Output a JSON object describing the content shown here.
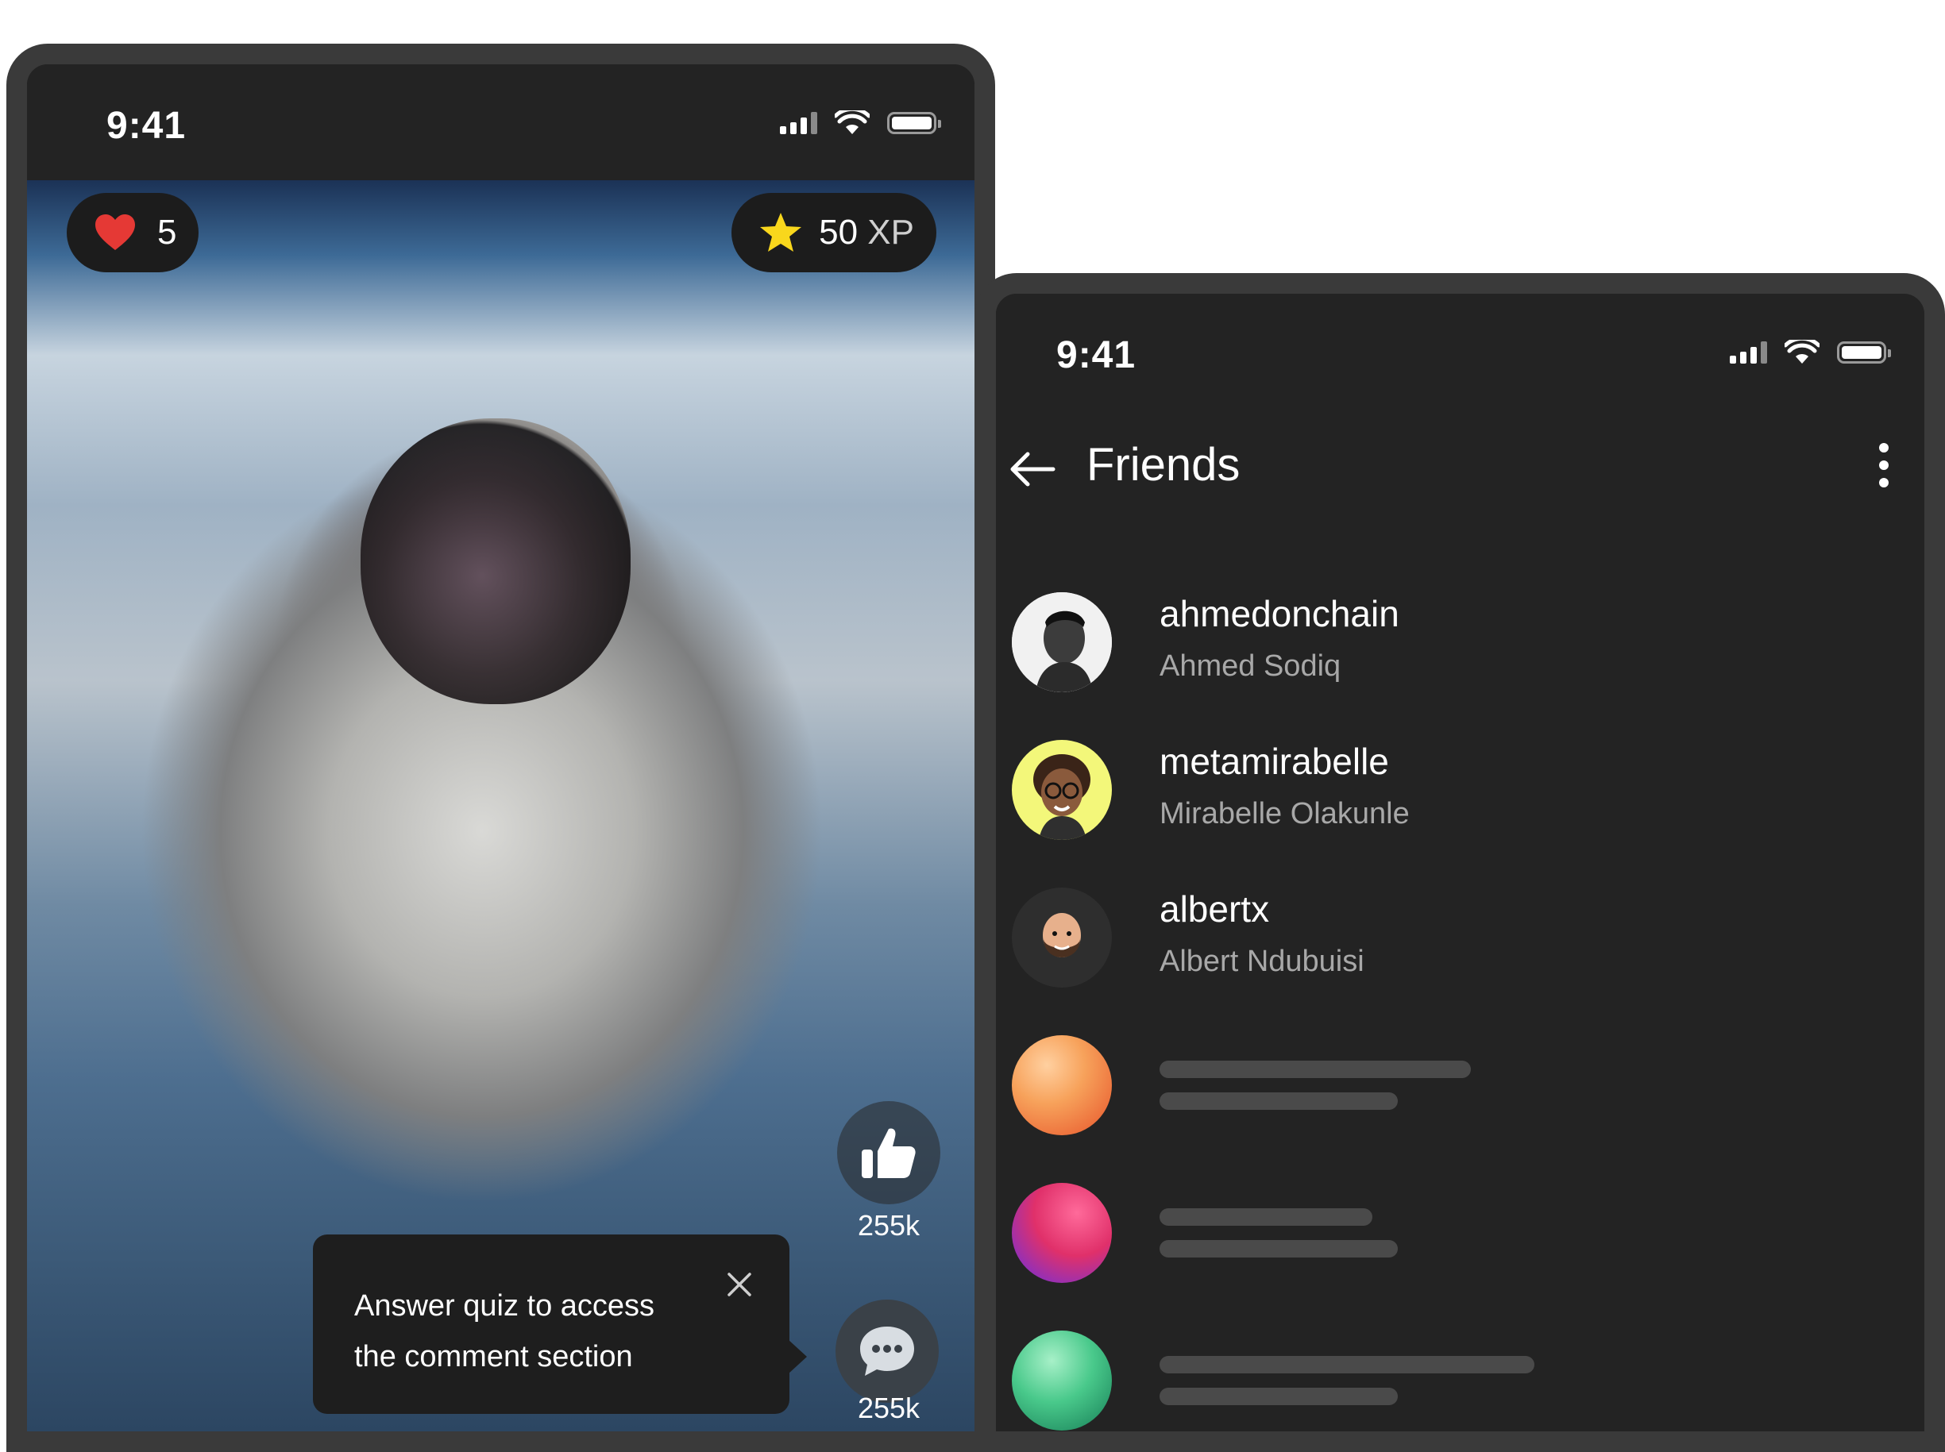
{
  "left_phone": {
    "status": {
      "time": "9:41"
    },
    "lives": {
      "icon": "heart-icon",
      "count": "5",
      "color": "#e53935"
    },
    "xp": {
      "icon": "star-icon",
      "value": "50",
      "unit": "XP",
      "color": "#f9d71c"
    },
    "actions": {
      "like": {
        "icon": "thumbs-up-icon",
        "count": "255k"
      },
      "comment": {
        "icon": "chat-bubble-icon",
        "count": "255k"
      }
    },
    "tooltip": {
      "line1": "Answer quiz to access",
      "line2": "the comment section",
      "close_icon": "close-icon"
    }
  },
  "right_phone": {
    "status": {
      "time": "9:41"
    },
    "header": {
      "back_icon": "arrow-left-icon",
      "title": "Friends",
      "menu_icon": "more-vertical-icon"
    },
    "friends": [
      {
        "username": "ahmedonchain",
        "name": "Ahmed Sodiq"
      },
      {
        "username": "metamirabelle",
        "name": "Mirabelle Olakunle"
      },
      {
        "username": "albertx",
        "name": "Albert Ndubuisi"
      }
    ],
    "loading_placeholders": 3
  },
  "colors": {
    "frame": "#3a3a3a",
    "background_dark": "#232323",
    "secondary_text": "#a8a8a8",
    "skeleton": "#4a4a4a"
  }
}
